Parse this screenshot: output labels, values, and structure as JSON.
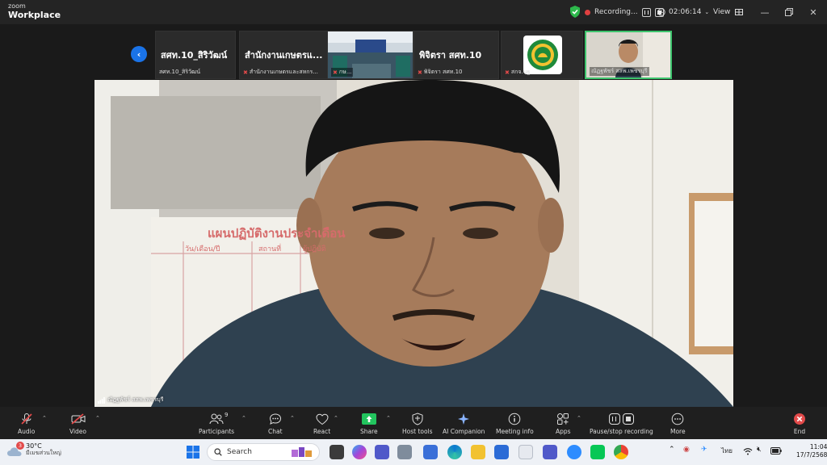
{
  "window": {
    "brand_top": "zoom",
    "brand_bottom": "Workplace",
    "recording_label": "Recording...",
    "timer": "02:06:14",
    "view_label": "View"
  },
  "thumbnails": [
    {
      "name": "สศท.10_สิริวัฒน์",
      "caption": "สศท.10_สิริวัฒน์",
      "muted": false
    },
    {
      "name": "สำนักงานเกษตรแ...",
      "caption": "สำนักงานเกษตรและสหกร...",
      "muted": true
    },
    {
      "name": "",
      "caption": "กษ...",
      "muted": true
    },
    {
      "name": "พิจิตรา สศท.10",
      "caption": "พิจิตรา สศท.10",
      "muted": true
    },
    {
      "name": "",
      "caption": "สกจ.นฐ",
      "muted": true
    },
    {
      "name": "",
      "caption": "ณัฏฐพัชร์ สสพ.เพชรบุรี",
      "muted": false
    }
  ],
  "main_video": {
    "speaker_name": "ณัฏฐพัชร์ สสพ.เพชรบุรี",
    "board_title": "แผนปฏิบัติงานประจำเดือน",
    "board_cols": [
      "วัน/เดือน/ปี",
      "สถานที่",
      "ผู้ปฏิบัติ"
    ]
  },
  "toolbar": {
    "audio": "Audio",
    "video": "Video",
    "participants": "Participants",
    "participants_count": "9",
    "chat": "Chat",
    "react": "React",
    "share": "Share",
    "host_tools": "Host tools",
    "ai_companion": "AI Companion",
    "meeting_info": "Meeting info",
    "apps": "Apps",
    "pause_stop_recording": "Pause/stop recording",
    "more": "More",
    "end": "End"
  },
  "taskbar": {
    "weather_badge": "3",
    "weather_temp": "30°C",
    "weather_desc": "มีเมฆส่วนใหญ่",
    "search_placeholder": "Search",
    "lang": "ไทย",
    "time": "11:04",
    "date": "17/7/2568"
  },
  "colors": {
    "accent_blue": "#1a73e8",
    "end_red": "#e24a4a",
    "share_green": "#22c55e",
    "active_border": "#3ec46d"
  }
}
